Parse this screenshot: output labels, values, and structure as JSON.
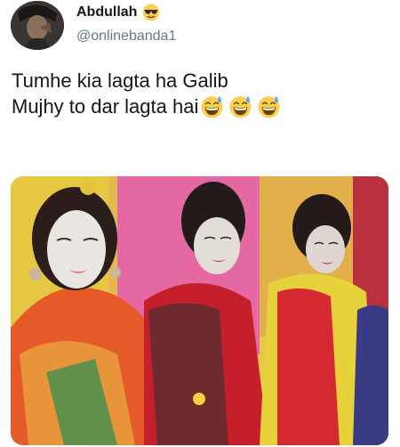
{
  "tweet": {
    "author": {
      "display_name": "Abdullah",
      "badge_emoji": "smiling-face-with-sunglasses-icon",
      "handle": "@onlinebanda1",
      "avatar": "user-avatar"
    },
    "text_lines": [
      "Tumhe kia lagta ha Galib",
      "Mujhy to dar lagta hai"
    ],
    "trailing_emojis": [
      "grinning-face-with-sweat-icon",
      "grinning-face-with-sweat-icon",
      "grinning-face-with-sweat-icon"
    ],
    "media": {
      "kind": "photo",
      "subject": "bridal-makeup-photo"
    }
  },
  "colors": {
    "text": "#14171a",
    "secondary_text": "#657786",
    "background": "#ffffff"
  }
}
